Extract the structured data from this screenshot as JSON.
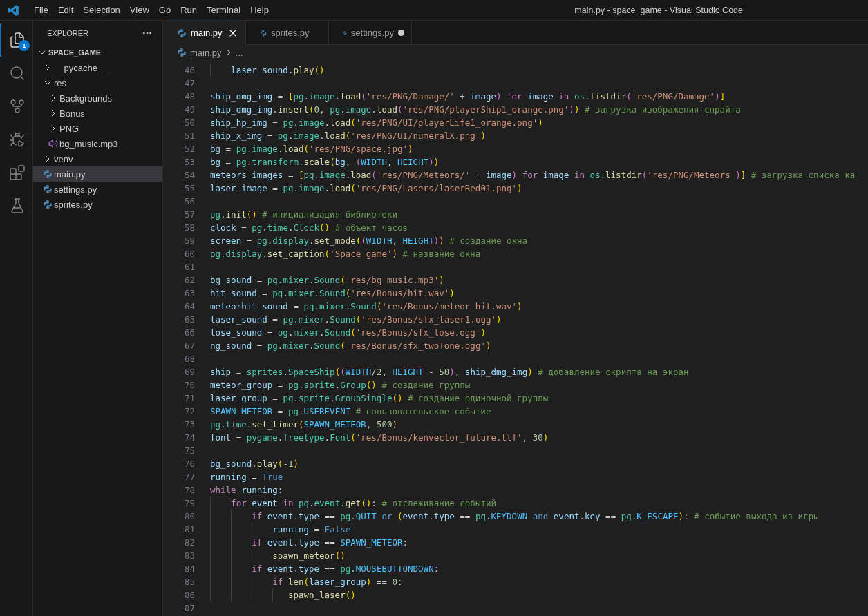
{
  "window": {
    "title": "main.py - space_game - Visual Studio Code"
  },
  "menu": [
    "File",
    "Edit",
    "Selection",
    "View",
    "Go",
    "Run",
    "Terminal",
    "Help"
  ],
  "activity_bar": [
    {
      "kind": "explorer",
      "selected": true,
      "badge": "1"
    },
    {
      "kind": "search",
      "selected": false
    },
    {
      "kind": "source_control",
      "selected": false
    },
    {
      "kind": "run",
      "selected": false
    },
    {
      "kind": "extensions",
      "selected": false
    },
    {
      "kind": "testing",
      "selected": false
    }
  ],
  "explorer": {
    "title": "EXPLORER",
    "tree": [
      {
        "label": "SPACE_GAME",
        "kind": "folder",
        "expanded": true,
        "selected": false,
        "children": [
          {
            "label": "__pycache__",
            "kind": "folder",
            "expanded": false,
            "selected": false
          },
          {
            "label": "res",
            "kind": "folder",
            "expanded": true,
            "selected": false,
            "children": [
              {
                "label": "Backgrounds",
                "kind": "folder",
                "expanded": false,
                "selected": false
              },
              {
                "label": "Bonus",
                "kind": "folder",
                "expanded": false,
                "selected": false
              },
              {
                "label": "PNG",
                "kind": "folder",
                "expanded": false,
                "selected": false
              },
              {
                "label": "bg_music.mp3",
                "kind": "audio",
                "selected": false
              }
            ]
          },
          {
            "label": "venv",
            "kind": "folder",
            "expanded": false,
            "selected": false
          },
          {
            "label": "main.py",
            "kind": "python",
            "selected": true
          },
          {
            "label": "settings.py",
            "kind": "python",
            "selected": false
          },
          {
            "label": "sprites.py",
            "kind": "python",
            "selected": false
          }
        ]
      }
    ]
  },
  "editor": {
    "tabs": [
      {
        "label": "main.py",
        "selected": true,
        "modified": false
      },
      {
        "label": "sprites.py",
        "selected": false,
        "modified": false
      },
      {
        "label": "settings.py",
        "selected": false,
        "modified": true
      }
    ],
    "breadcrumb": [
      "main.py",
      "..."
    ],
    "lines": [
      {
        "number": "46",
        "tokens": [
          {
            "kind": "var",
            "text": "    laser_sound."
          },
          {
            "kind": "fn",
            "text": "play"
          },
          {
            "kind": "br1",
            "text": "()"
          }
        ]
      },
      {
        "number": "47"
      },
      {
        "number": "48",
        "tokens": [
          {
            "kind": "var",
            "text": "ship_dmg_img"
          },
          {
            "kind": "plain",
            "text": " = "
          },
          {
            "kind": "br1",
            "text": "["
          },
          {
            "kind": "mod",
            "text": "pg"
          },
          {
            "kind": "plain",
            "text": "."
          },
          {
            "kind": "mod",
            "text": "image"
          },
          {
            "kind": "plain",
            "text": "."
          },
          {
            "kind": "fn",
            "text": "load"
          },
          {
            "kind": "br2",
            "text": "("
          },
          {
            "kind": "str",
            "text": "'res/PNG/Damage/'"
          },
          {
            "kind": "plain",
            "text": " + "
          },
          {
            "kind": "var",
            "text": "image"
          },
          {
            "kind": "br2",
            "text": ") "
          },
          {
            "kind": "ctl",
            "text": "for "
          },
          {
            "kind": "var",
            "text": "image "
          },
          {
            "kind": "ctl",
            "text": "in "
          },
          {
            "kind": "mod",
            "text": "os"
          },
          {
            "kind": "plain",
            "text": "."
          },
          {
            "kind": "fn",
            "text": "listdir"
          },
          {
            "kind": "br2",
            "text": "("
          },
          {
            "kind": "str",
            "text": "'res/PNG/Damage'"
          },
          {
            "kind": "br2",
            "text": ")"
          },
          {
            "kind": "br1",
            "text": "]"
          }
        ]
      },
      {
        "number": "49",
        "tokens": [
          {
            "kind": "var",
            "text": "ship_dmg_img"
          },
          {
            "kind": "plain",
            "text": "."
          },
          {
            "kind": "fn",
            "text": "insert"
          },
          {
            "kind": "br1",
            "text": "("
          },
          {
            "kind": "num",
            "text": "0"
          },
          {
            "kind": "plain",
            "text": ", "
          },
          {
            "kind": "mod",
            "text": "pg"
          },
          {
            "kind": "plain",
            "text": "."
          },
          {
            "kind": "mod",
            "text": "image"
          },
          {
            "kind": "plain",
            "text": "."
          },
          {
            "kind": "fn",
            "text": "load"
          },
          {
            "kind": "br2",
            "text": "("
          },
          {
            "kind": "str",
            "text": "'res/PNG/playerShip1_orange.png'"
          },
          {
            "kind": "br2",
            "text": ")"
          },
          {
            "kind": "br1",
            "text": ") "
          },
          {
            "kind": "com",
            "text": "# загрузка изображения спрайта"
          }
        ]
      },
      {
        "number": "50",
        "tokens": [
          {
            "kind": "var",
            "text": "ship_hp_img"
          },
          {
            "kind": "plain",
            "text": " = "
          },
          {
            "kind": "mod",
            "text": "pg"
          },
          {
            "kind": "plain",
            "text": "."
          },
          {
            "kind": "mod",
            "text": "image"
          },
          {
            "kind": "plain",
            "text": "."
          },
          {
            "kind": "fn",
            "text": "load"
          },
          {
            "kind": "br1",
            "text": "("
          },
          {
            "kind": "str",
            "text": "'res/PNG/UI/playerLife1_orange.png'"
          },
          {
            "kind": "br1",
            "text": ")"
          }
        ]
      },
      {
        "number": "51",
        "tokens": [
          {
            "kind": "var",
            "text": "ship_x_img"
          },
          {
            "kind": "plain",
            "text": " = "
          },
          {
            "kind": "mod",
            "text": "pg"
          },
          {
            "kind": "plain",
            "text": "."
          },
          {
            "kind": "mod",
            "text": "image"
          },
          {
            "kind": "plain",
            "text": "."
          },
          {
            "kind": "fn",
            "text": "load"
          },
          {
            "kind": "br1",
            "text": "("
          },
          {
            "kind": "str",
            "text": "'res/PNG/UI/numeralX.png'"
          },
          {
            "kind": "br1",
            "text": ")"
          }
        ]
      },
      {
        "number": "52",
        "tokens": [
          {
            "kind": "var",
            "text": "bg"
          },
          {
            "kind": "plain",
            "text": " = "
          },
          {
            "kind": "mod",
            "text": "pg"
          },
          {
            "kind": "plain",
            "text": "."
          },
          {
            "kind": "mod",
            "text": "image"
          },
          {
            "kind": "plain",
            "text": "."
          },
          {
            "kind": "fn",
            "text": "load"
          },
          {
            "kind": "br1",
            "text": "("
          },
          {
            "kind": "str",
            "text": "'res/PNG/space.jpg'"
          },
          {
            "kind": "br1",
            "text": ")"
          }
        ]
      },
      {
        "number": "53",
        "tokens": [
          {
            "kind": "var",
            "text": "bg"
          },
          {
            "kind": "plain",
            "text": " = "
          },
          {
            "kind": "mod",
            "text": "pg"
          },
          {
            "kind": "plain",
            "text": "."
          },
          {
            "kind": "mod",
            "text": "transform"
          },
          {
            "kind": "plain",
            "text": "."
          },
          {
            "kind": "fn",
            "text": "scale"
          },
          {
            "kind": "br1",
            "text": "("
          },
          {
            "kind": "var",
            "text": "bg"
          },
          {
            "kind": "plain",
            "text": ", "
          },
          {
            "kind": "br2",
            "text": "("
          },
          {
            "kind": "const",
            "text": "WIDTH"
          },
          {
            "kind": "plain",
            "text": ", "
          },
          {
            "kind": "const",
            "text": "HEIGHT"
          },
          {
            "kind": "br2",
            "text": ")"
          },
          {
            "kind": "br1",
            "text": ")"
          }
        ]
      },
      {
        "number": "54",
        "tokens": [
          {
            "kind": "var",
            "text": "meteors_images"
          },
          {
            "kind": "plain",
            "text": " = "
          },
          {
            "kind": "br1",
            "text": "["
          },
          {
            "kind": "mod",
            "text": "pg"
          },
          {
            "kind": "plain",
            "text": "."
          },
          {
            "kind": "mod",
            "text": "image"
          },
          {
            "kind": "plain",
            "text": "."
          },
          {
            "kind": "fn",
            "text": "load"
          },
          {
            "kind": "br2",
            "text": "("
          },
          {
            "kind": "str",
            "text": "'res/PNG/Meteors/'"
          },
          {
            "kind": "plain",
            "text": " + "
          },
          {
            "kind": "var",
            "text": "image"
          },
          {
            "kind": "br2",
            "text": ") "
          },
          {
            "kind": "ctl",
            "text": "for "
          },
          {
            "kind": "var",
            "text": "image "
          },
          {
            "kind": "ctl",
            "text": "in "
          },
          {
            "kind": "mod",
            "text": "os"
          },
          {
            "kind": "plain",
            "text": "."
          },
          {
            "kind": "fn",
            "text": "listdir"
          },
          {
            "kind": "br2",
            "text": "("
          },
          {
            "kind": "str",
            "text": "'res/PNG/Meteors'"
          },
          {
            "kind": "br2",
            "text": ")"
          },
          {
            "kind": "br1",
            "text": "] "
          },
          {
            "kind": "com",
            "text": "# загрузка списка ка"
          }
        ]
      },
      {
        "number": "55",
        "tokens": [
          {
            "kind": "var",
            "text": "laser_image"
          },
          {
            "kind": "plain",
            "text": " = "
          },
          {
            "kind": "mod",
            "text": "pg"
          },
          {
            "kind": "plain",
            "text": "."
          },
          {
            "kind": "mod",
            "text": "image"
          },
          {
            "kind": "plain",
            "text": "."
          },
          {
            "kind": "fn",
            "text": "load"
          },
          {
            "kind": "br1",
            "text": "("
          },
          {
            "kind": "str",
            "text": "'res/PNG/Lasers/laserRed01.png'"
          },
          {
            "kind": "br1",
            "text": ")"
          }
        ]
      },
      {
        "number": "56"
      },
      {
        "number": "57",
        "tokens": [
          {
            "kind": "mod",
            "text": "pg"
          },
          {
            "kind": "plain",
            "text": "."
          },
          {
            "kind": "fn",
            "text": "init"
          },
          {
            "kind": "br1",
            "text": "() "
          },
          {
            "kind": "com",
            "text": "# инициализация библиотеки"
          }
        ]
      },
      {
        "number": "58",
        "tokens": [
          {
            "kind": "var",
            "text": "clock"
          },
          {
            "kind": "plain",
            "text": " = "
          },
          {
            "kind": "mod",
            "text": "pg"
          },
          {
            "kind": "plain",
            "text": "."
          },
          {
            "kind": "mod",
            "text": "time"
          },
          {
            "kind": "plain",
            "text": "."
          },
          {
            "kind": "mod",
            "text": "Clock"
          },
          {
            "kind": "br1",
            "text": "() "
          },
          {
            "kind": "com",
            "text": "# объект часов"
          }
        ]
      },
      {
        "number": "59",
        "tokens": [
          {
            "kind": "var",
            "text": "screen"
          },
          {
            "kind": "plain",
            "text": " = "
          },
          {
            "kind": "mod",
            "text": "pg"
          },
          {
            "kind": "plain",
            "text": "."
          },
          {
            "kind": "mod",
            "text": "display"
          },
          {
            "kind": "plain",
            "text": "."
          },
          {
            "kind": "fn",
            "text": "set_mode"
          },
          {
            "kind": "br1",
            "text": "("
          },
          {
            "kind": "br2",
            "text": "("
          },
          {
            "kind": "const",
            "text": "WIDTH"
          },
          {
            "kind": "plain",
            "text": ", "
          },
          {
            "kind": "const",
            "text": "HEIGHT"
          },
          {
            "kind": "br2",
            "text": ")"
          },
          {
            "kind": "br1",
            "text": ") "
          },
          {
            "kind": "com",
            "text": "# создание окна"
          }
        ]
      },
      {
        "number": "60",
        "tokens": [
          {
            "kind": "mod",
            "text": "pg"
          },
          {
            "kind": "plain",
            "text": "."
          },
          {
            "kind": "mod",
            "text": "display"
          },
          {
            "kind": "plain",
            "text": "."
          },
          {
            "kind": "fn",
            "text": "set_caption"
          },
          {
            "kind": "br1",
            "text": "("
          },
          {
            "kind": "str",
            "text": "'Space game'"
          },
          {
            "kind": "br1",
            "text": ") "
          },
          {
            "kind": "com",
            "text": "# название окна"
          }
        ]
      },
      {
        "number": "61"
      },
      {
        "number": "62",
        "tokens": [
          {
            "kind": "var",
            "text": "bg_sound"
          },
          {
            "kind": "plain",
            "text": " = "
          },
          {
            "kind": "mod",
            "text": "pg"
          },
          {
            "kind": "plain",
            "text": "."
          },
          {
            "kind": "mod",
            "text": "mixer"
          },
          {
            "kind": "plain",
            "text": "."
          },
          {
            "kind": "mod",
            "text": "Sound"
          },
          {
            "kind": "br1",
            "text": "("
          },
          {
            "kind": "str",
            "text": "'res/bg_music.mp3'"
          },
          {
            "kind": "br1",
            "text": ")"
          }
        ]
      },
      {
        "number": "63",
        "tokens": [
          {
            "kind": "var",
            "text": "hit_sound"
          },
          {
            "kind": "plain",
            "text": " = "
          },
          {
            "kind": "mod",
            "text": "pg"
          },
          {
            "kind": "plain",
            "text": "."
          },
          {
            "kind": "mod",
            "text": "mixer"
          },
          {
            "kind": "plain",
            "text": "."
          },
          {
            "kind": "mod",
            "text": "Sound"
          },
          {
            "kind": "br1",
            "text": "("
          },
          {
            "kind": "str",
            "text": "'res/Bonus/hit.wav'"
          },
          {
            "kind": "br1",
            "text": ")"
          }
        ]
      },
      {
        "number": "64",
        "tokens": [
          {
            "kind": "var",
            "text": "meteorhit_sound"
          },
          {
            "kind": "plain",
            "text": " = "
          },
          {
            "kind": "mod",
            "text": "pg"
          },
          {
            "kind": "plain",
            "text": "."
          },
          {
            "kind": "mod",
            "text": "mixer"
          },
          {
            "kind": "plain",
            "text": "."
          },
          {
            "kind": "mod",
            "text": "Sound"
          },
          {
            "kind": "br1",
            "text": "("
          },
          {
            "kind": "str",
            "text": "'res/Bonus/meteor_hit.wav'"
          },
          {
            "kind": "br1",
            "text": ")"
          }
        ]
      },
      {
        "number": "65",
        "tokens": [
          {
            "kind": "var",
            "text": "laser_sound"
          },
          {
            "kind": "plain",
            "text": " = "
          },
          {
            "kind": "mod",
            "text": "pg"
          },
          {
            "kind": "plain",
            "text": "."
          },
          {
            "kind": "mod",
            "text": "mixer"
          },
          {
            "kind": "plain",
            "text": "."
          },
          {
            "kind": "mod",
            "text": "Sound"
          },
          {
            "kind": "br1",
            "text": "("
          },
          {
            "kind": "str",
            "text": "'res/Bonus/sfx_laser1.ogg'"
          },
          {
            "kind": "br1",
            "text": ")"
          }
        ]
      },
      {
        "number": "66",
        "tokens": [
          {
            "kind": "var",
            "text": "lose_sound"
          },
          {
            "kind": "plain",
            "text": " = "
          },
          {
            "kind": "mod",
            "text": "pg"
          },
          {
            "kind": "plain",
            "text": "."
          },
          {
            "kind": "mod",
            "text": "mixer"
          },
          {
            "kind": "plain",
            "text": "."
          },
          {
            "kind": "mod",
            "text": "Sound"
          },
          {
            "kind": "br1",
            "text": "("
          },
          {
            "kind": "str",
            "text": "'res/Bonus/sfx_lose.ogg'"
          },
          {
            "kind": "br1",
            "text": ")"
          }
        ]
      },
      {
        "number": "67",
        "tokens": [
          {
            "kind": "var",
            "text": "ng_sound"
          },
          {
            "kind": "plain",
            "text": " = "
          },
          {
            "kind": "mod",
            "text": "pg"
          },
          {
            "kind": "plain",
            "text": "."
          },
          {
            "kind": "mod",
            "text": "mixer"
          },
          {
            "kind": "plain",
            "text": "."
          },
          {
            "kind": "mod",
            "text": "Sound"
          },
          {
            "kind": "br1",
            "text": "("
          },
          {
            "kind": "str",
            "text": "'res/Bonus/sfx_twoTone.ogg'"
          },
          {
            "kind": "br1",
            "text": ")"
          }
        ]
      },
      {
        "number": "68"
      },
      {
        "number": "69",
        "tokens": [
          {
            "kind": "var",
            "text": "ship"
          },
          {
            "kind": "plain",
            "text": " = "
          },
          {
            "kind": "mod",
            "text": "sprites"
          },
          {
            "kind": "plain",
            "text": "."
          },
          {
            "kind": "mod",
            "text": "SpaceShip"
          },
          {
            "kind": "br1",
            "text": "("
          },
          {
            "kind": "br2",
            "text": "("
          },
          {
            "kind": "const",
            "text": "WIDTH"
          },
          {
            "kind": "plain",
            "text": "/"
          },
          {
            "kind": "num",
            "text": "2"
          },
          {
            "kind": "plain",
            "text": ", "
          },
          {
            "kind": "const",
            "text": "HEIGHT"
          },
          {
            "kind": "plain",
            "text": " - "
          },
          {
            "kind": "num",
            "text": "50"
          },
          {
            "kind": "br2",
            "text": ")"
          },
          {
            "kind": "plain",
            "text": ", "
          },
          {
            "kind": "var",
            "text": "ship_dmg_img"
          },
          {
            "kind": "br1",
            "text": ") "
          },
          {
            "kind": "com",
            "text": "# добавление скрипта на экран"
          }
        ]
      },
      {
        "number": "70",
        "tokens": [
          {
            "kind": "var",
            "text": "meteor_group"
          },
          {
            "kind": "plain",
            "text": " = "
          },
          {
            "kind": "mod",
            "text": "pg"
          },
          {
            "kind": "plain",
            "text": "."
          },
          {
            "kind": "mod",
            "text": "sprite"
          },
          {
            "kind": "plain",
            "text": "."
          },
          {
            "kind": "mod",
            "text": "Group"
          },
          {
            "kind": "br1",
            "text": "() "
          },
          {
            "kind": "com",
            "text": "# создание группы"
          }
        ]
      },
      {
        "number": "71",
        "tokens": [
          {
            "kind": "var",
            "text": "laser_group"
          },
          {
            "kind": "plain",
            "text": " = "
          },
          {
            "kind": "mod",
            "text": "pg"
          },
          {
            "kind": "plain",
            "text": "."
          },
          {
            "kind": "mod",
            "text": "sprite"
          },
          {
            "kind": "plain",
            "text": "."
          },
          {
            "kind": "mod",
            "text": "GroupSingle"
          },
          {
            "kind": "br1",
            "text": "() "
          },
          {
            "kind": "com",
            "text": "# создание одиночной группы"
          }
        ]
      },
      {
        "number": "72",
        "tokens": [
          {
            "kind": "const",
            "text": "SPAWN_METEOR"
          },
          {
            "kind": "plain",
            "text": " = "
          },
          {
            "kind": "mod",
            "text": "pg"
          },
          {
            "kind": "plain",
            "text": "."
          },
          {
            "kind": "const",
            "text": "USEREVENT "
          },
          {
            "kind": "com",
            "text": "# пользовательское событие"
          }
        ]
      },
      {
        "number": "73",
        "tokens": [
          {
            "kind": "mod",
            "text": "pg"
          },
          {
            "kind": "plain",
            "text": "."
          },
          {
            "kind": "mod",
            "text": "time"
          },
          {
            "kind": "plain",
            "text": "."
          },
          {
            "kind": "fn",
            "text": "set_timer"
          },
          {
            "kind": "br1",
            "text": "("
          },
          {
            "kind": "const",
            "text": "SPAWN_METEOR"
          },
          {
            "kind": "plain",
            "text": ", "
          },
          {
            "kind": "num",
            "text": "500"
          },
          {
            "kind": "br1",
            "text": ")"
          }
        ]
      },
      {
        "number": "74",
        "tokens": [
          {
            "kind": "var",
            "text": "font"
          },
          {
            "kind": "plain",
            "text": " = "
          },
          {
            "kind": "mod",
            "text": "pygame"
          },
          {
            "kind": "plain",
            "text": "."
          },
          {
            "kind": "mod",
            "text": "freetype"
          },
          {
            "kind": "plain",
            "text": "."
          },
          {
            "kind": "mod",
            "text": "Font"
          },
          {
            "kind": "br1",
            "text": "("
          },
          {
            "kind": "str",
            "text": "'res/Bonus/kenvector_future.ttf'"
          },
          {
            "kind": "plain",
            "text": ", "
          },
          {
            "kind": "num",
            "text": "30"
          },
          {
            "kind": "br1",
            "text": ")"
          }
        ]
      },
      {
        "number": "75"
      },
      {
        "number": "76",
        "tokens": [
          {
            "kind": "var",
            "text": "bg_sound"
          },
          {
            "kind": "plain",
            "text": "."
          },
          {
            "kind": "fn",
            "text": "play"
          },
          {
            "kind": "br1",
            "text": "("
          },
          {
            "kind": "num",
            "text": "-1"
          },
          {
            "kind": "br1",
            "text": ")"
          }
        ]
      },
      {
        "number": "77",
        "tokens": [
          {
            "kind": "var",
            "text": "running"
          },
          {
            "kind": "plain",
            "text": " = "
          },
          {
            "kind": "kw",
            "text": "True"
          }
        ]
      },
      {
        "number": "78",
        "tokens": [
          {
            "kind": "ctl",
            "text": "while "
          },
          {
            "kind": "var",
            "text": "running"
          },
          {
            "kind": "plain",
            "text": ":"
          }
        ]
      },
      {
        "number": "79",
        "tokens": [
          {
            "kind": "ctl",
            "text": "    for "
          },
          {
            "kind": "var",
            "text": "event "
          },
          {
            "kind": "ctl",
            "text": "in "
          },
          {
            "kind": "mod",
            "text": "pg"
          },
          {
            "kind": "plain",
            "text": "."
          },
          {
            "kind": "mod",
            "text": "event"
          },
          {
            "kind": "plain",
            "text": "."
          },
          {
            "kind": "fn",
            "text": "get"
          },
          {
            "kind": "br1",
            "text": "()"
          },
          {
            "kind": "plain",
            "text": ": "
          },
          {
            "kind": "com",
            "text": "# отслеживание событий"
          }
        ]
      },
      {
        "number": "80",
        "tokens": [
          {
            "kind": "ctl",
            "text": "        if "
          },
          {
            "kind": "var",
            "text": "event"
          },
          {
            "kind": "plain",
            "text": "."
          },
          {
            "kind": "var",
            "text": "type"
          },
          {
            "kind": "plain",
            "text": " == "
          },
          {
            "kind": "mod",
            "text": "pg"
          },
          {
            "kind": "plain",
            "text": "."
          },
          {
            "kind": "const",
            "text": "QUIT "
          },
          {
            "kind": "kw",
            "text": "or "
          },
          {
            "kind": "br1",
            "text": "("
          },
          {
            "kind": "var",
            "text": "event"
          },
          {
            "kind": "plain",
            "text": "."
          },
          {
            "kind": "var",
            "text": "type"
          },
          {
            "kind": "plain",
            "text": " == "
          },
          {
            "kind": "mod",
            "text": "pg"
          },
          {
            "kind": "plain",
            "text": "."
          },
          {
            "kind": "const",
            "text": "KEYDOWN "
          },
          {
            "kind": "kw",
            "text": "and "
          },
          {
            "kind": "var",
            "text": "event"
          },
          {
            "kind": "plain",
            "text": "."
          },
          {
            "kind": "var",
            "text": "key"
          },
          {
            "kind": "plain",
            "text": " == "
          },
          {
            "kind": "mod",
            "text": "pg"
          },
          {
            "kind": "plain",
            "text": "."
          },
          {
            "kind": "const",
            "text": "K_ESCAPE"
          },
          {
            "kind": "br1",
            "text": ")"
          },
          {
            "kind": "plain",
            "text": ": "
          },
          {
            "kind": "com",
            "text": "# событие выхода из игры"
          }
        ]
      },
      {
        "number": "81",
        "tokens": [
          {
            "kind": "var",
            "text": "            running"
          },
          {
            "kind": "plain",
            "text": " = "
          },
          {
            "kind": "kw",
            "text": "False"
          }
        ]
      },
      {
        "number": "82",
        "tokens": [
          {
            "kind": "ctl",
            "text": "        if "
          },
          {
            "kind": "var",
            "text": "event"
          },
          {
            "kind": "plain",
            "text": "."
          },
          {
            "kind": "var",
            "text": "type"
          },
          {
            "kind": "plain",
            "text": " == "
          },
          {
            "kind": "const",
            "text": "SPAWN_METEOR"
          },
          {
            "kind": "plain",
            "text": ":"
          }
        ]
      },
      {
        "number": "83",
        "tokens": [
          {
            "kind": "fn",
            "text": "            spawn_meteor"
          },
          {
            "kind": "br1",
            "text": "()"
          }
        ]
      },
      {
        "number": "84",
        "tokens": [
          {
            "kind": "ctl",
            "text": "        if "
          },
          {
            "kind": "var",
            "text": "event"
          },
          {
            "kind": "plain",
            "text": "."
          },
          {
            "kind": "var",
            "text": "type"
          },
          {
            "kind": "plain",
            "text": " == "
          },
          {
            "kind": "mod",
            "text": "pg"
          },
          {
            "kind": "plain",
            "text": "."
          },
          {
            "kind": "const",
            "text": "MOUSEBUTTONDOWN"
          },
          {
            "kind": "plain",
            "text": ":"
          }
        ]
      },
      {
        "number": "85",
        "tokens": [
          {
            "kind": "ctl",
            "text": "            if "
          },
          {
            "kind": "fn",
            "text": "len"
          },
          {
            "kind": "br1",
            "text": "("
          },
          {
            "kind": "var",
            "text": "laser_group"
          },
          {
            "kind": "br1",
            "text": ")"
          },
          {
            "kind": "plain",
            "text": " == "
          },
          {
            "kind": "num",
            "text": "0"
          },
          {
            "kind": "plain",
            "text": ":"
          }
        ]
      },
      {
        "number": "86",
        "tokens": [
          {
            "kind": "fn",
            "text": "               spawn_laser"
          },
          {
            "kind": "br1",
            "text": "()"
          }
        ]
      },
      {
        "number": "87"
      }
    ]
  }
}
